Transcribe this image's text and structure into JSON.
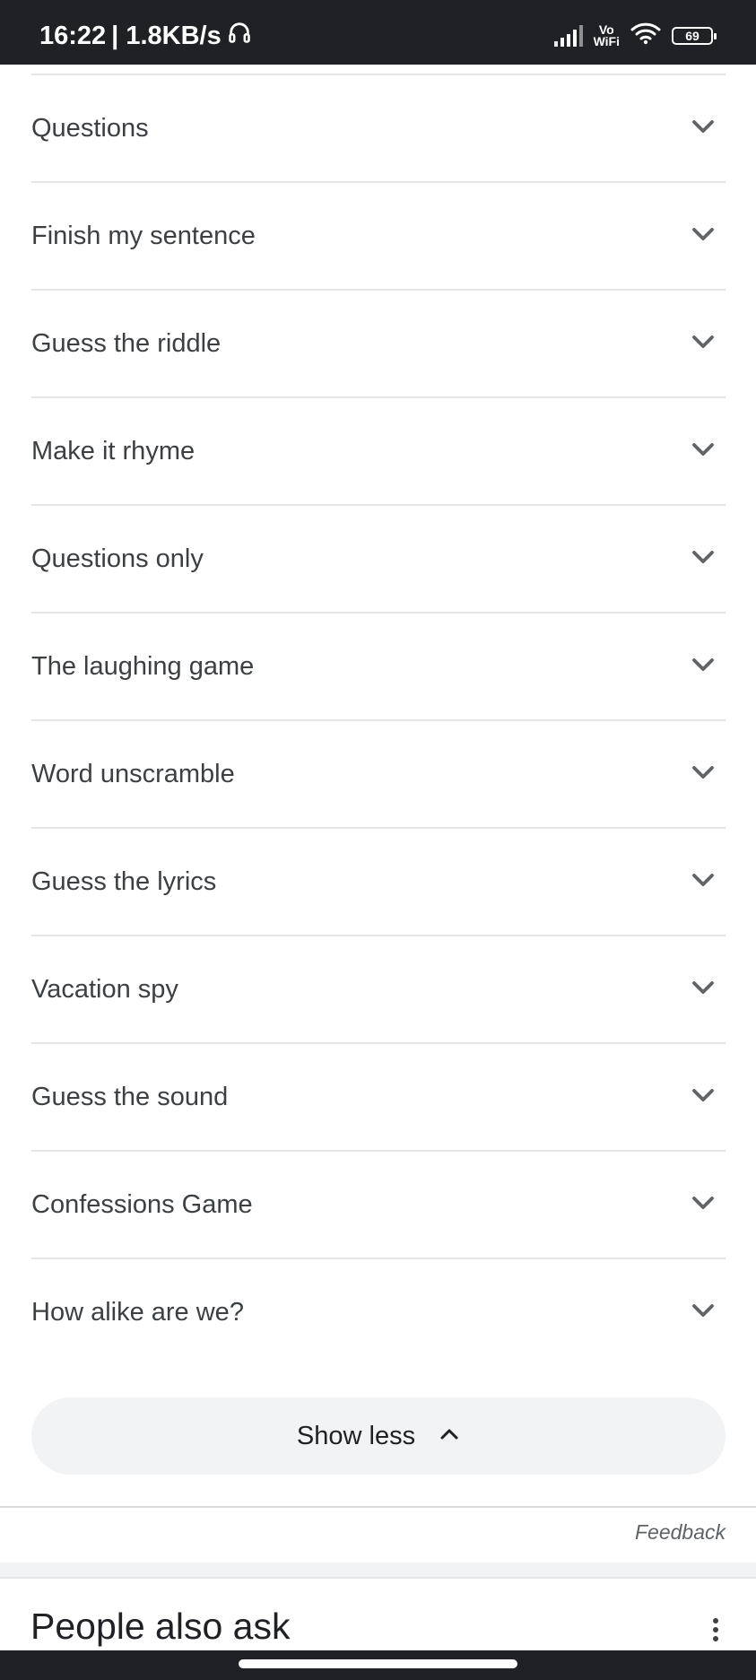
{
  "status_bar": {
    "time": "16:22",
    "speed": "| 1.8KB/s",
    "vowifi_top": "Vo",
    "vowifi_bottom": "WiFi",
    "battery": "69",
    "icons": [
      "headphones-icon",
      "signal-icon",
      "wifi-icon",
      "battery-icon"
    ]
  },
  "accordion": {
    "items": [
      {
        "label": "Questions"
      },
      {
        "label": "Finish my sentence"
      },
      {
        "label": "Guess the riddle"
      },
      {
        "label": "Make it rhyme"
      },
      {
        "label": "Questions only"
      },
      {
        "label": "The laughing game"
      },
      {
        "label": "Word unscramble"
      },
      {
        "label": "Guess the lyrics"
      },
      {
        "label": "Vacation spy"
      },
      {
        "label": "Guess the sound"
      },
      {
        "label": "Confessions Game"
      },
      {
        "label": "How alike are we?"
      }
    ],
    "chevron_icon": "chevron-down-icon"
  },
  "show_less": {
    "label": "Show less",
    "icon": "chevron-up-icon"
  },
  "feedback": {
    "label": "Feedback"
  },
  "people_also_ask": {
    "title": "People also ask",
    "menu_icon": "more-vert-icon"
  },
  "colors": {
    "text": "#3c4043",
    "divider": "#e4e5e7",
    "button_bg": "#f1f3f4",
    "status_bg": "#202124"
  }
}
